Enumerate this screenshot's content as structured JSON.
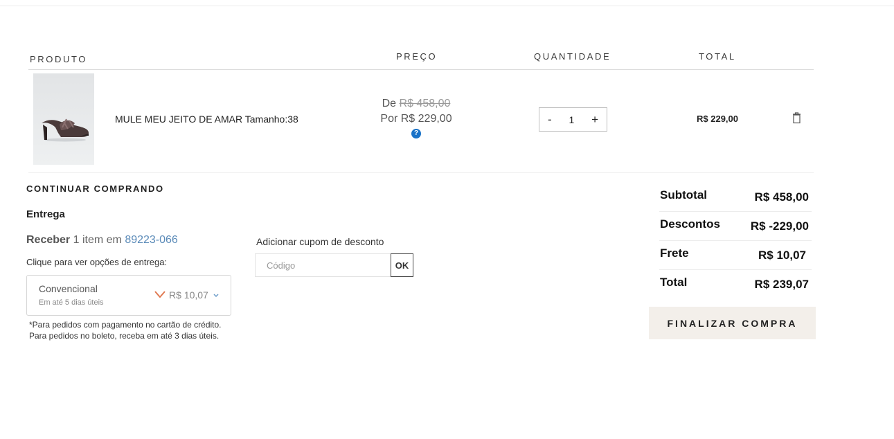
{
  "table": {
    "headers": {
      "product": "PRODUTO",
      "price": "PREÇO",
      "quantity": "QUANTIDADE",
      "total": "TOTAL"
    }
  },
  "item": {
    "name": "MULE MEU JEITO DE AMAR Tamanho:38",
    "price_old_prefix": "De",
    "price_old": "R$ 458,00",
    "price_new_prefix": "Por",
    "price_new": "R$ 229,00",
    "help_glyph": "?",
    "quantity": "1",
    "qty_minus": "-",
    "qty_plus": "+",
    "total": "R$ 229,00"
  },
  "continue_label": "CONTINUAR COMPRANDO",
  "delivery": {
    "title": "Entrega",
    "receive_bold": "Receber",
    "receive_text": "1 item em",
    "cep": "89223-066",
    "prompt": "Clique para ver opções de entrega:",
    "option_name": "Convencional",
    "option_eta": "Em até 5 dias úteis",
    "option_price": "R$ 10,07",
    "notes_line1": "*Para pedidos com pagamento no cartão de crédito.",
    "notes_line2": "Para pedidos no boleto, receba em até 3 dias úteis."
  },
  "coupon": {
    "label": "Adicionar cupom de desconto",
    "placeholder": "Código",
    "ok_label": "OK"
  },
  "summary": {
    "rows": [
      {
        "label": "Subtotal",
        "value": "R$ 458,00"
      },
      {
        "label": "Descontos",
        "value": "R$ -229,00"
      },
      {
        "label": "Frete",
        "value": "R$ 10,07"
      },
      {
        "label": "Total",
        "value": "R$ 239,07"
      }
    ],
    "checkout_label": "FINALIZAR COMPRA"
  },
  "colors": {
    "accent_blue": "#1a73c8",
    "cep_link": "#5a8ab8",
    "checkout_bg": "#f3efea",
    "shipping_arrow": "#e07a52"
  },
  "icons": {
    "trash": "trash-icon",
    "help": "help-icon",
    "shipping_arrow": "chevron-down-icon",
    "caret": "caret-down-icon"
  }
}
